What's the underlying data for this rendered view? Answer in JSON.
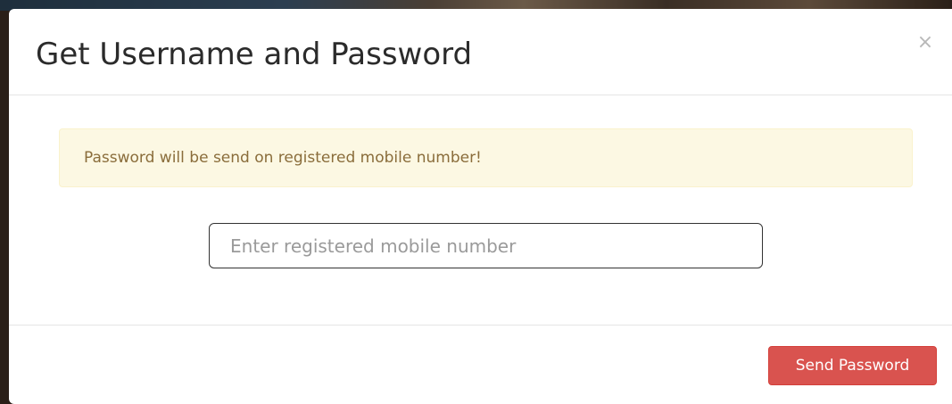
{
  "modal": {
    "title": "Get Username and Password",
    "close_symbol": "×"
  },
  "alert": {
    "message": "Password will be send on registered mobile number!",
    "type": "warning"
  },
  "mobile_input": {
    "value": "",
    "placeholder": "Enter registered mobile number"
  },
  "footer": {
    "send_label": "Send Password"
  },
  "colors": {
    "alert_background": "#fcf8e3",
    "alert_text": "#8a6d3b",
    "send_button": "#d9534f",
    "title_text": "#2b2b2b"
  },
  "icons": {
    "close": "close-icon"
  }
}
